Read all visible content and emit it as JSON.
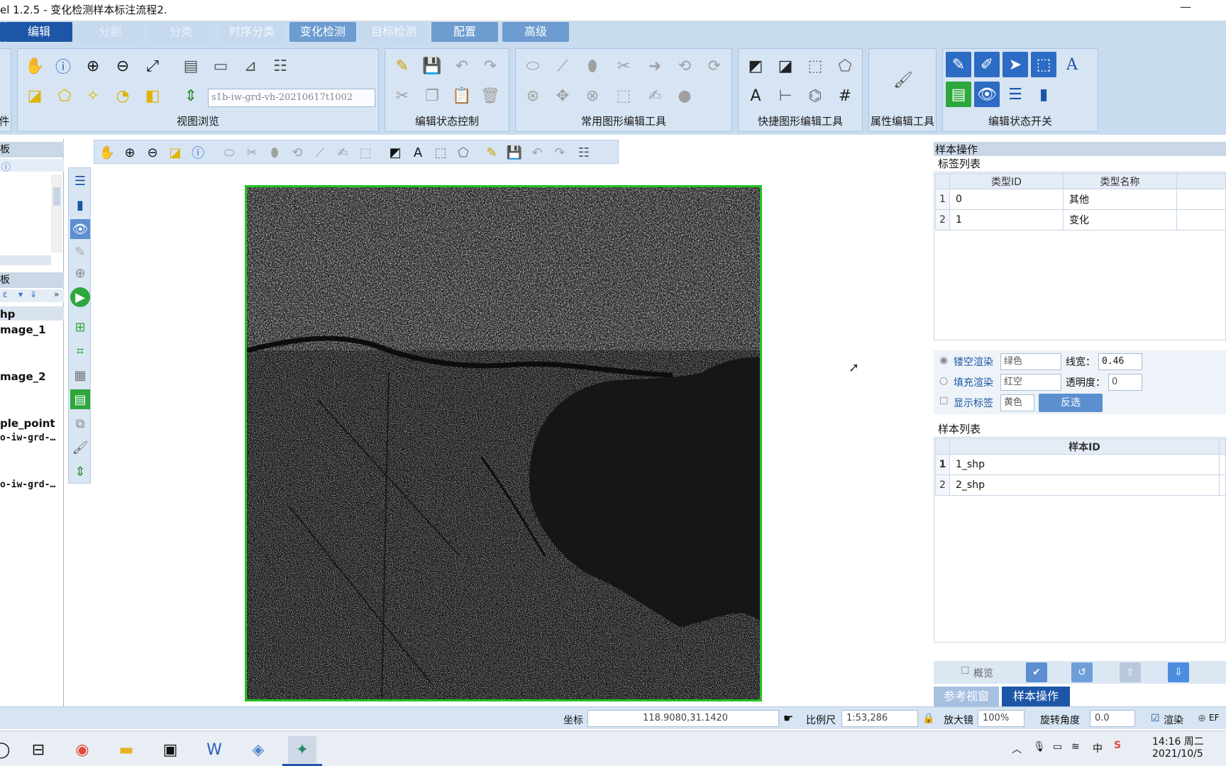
{
  "window": {
    "title": "el 1.2.5 - 变化检测样本标注流程2.",
    "minimize": "—"
  },
  "tabs": [
    {
      "label": "编辑",
      "state": "active"
    },
    {
      "label": "分割",
      "state": "dim"
    },
    {
      "label": "分类",
      "state": "dim"
    },
    {
      "label": "时序分类",
      "state": "normal"
    },
    {
      "label": "变化检测",
      "state": "normal"
    },
    {
      "label": "目标检测",
      "state": "normal"
    },
    {
      "label": "配置",
      "state": "normal"
    },
    {
      "label": "高级",
      "state": "normal"
    }
  ],
  "ribbon": {
    "left_fragment": "件",
    "groups": {
      "view_browse": "视图浏览",
      "edit_state_control": "编辑状态控制",
      "common_shape_tools": "常用图形编辑工具",
      "quick_shape_tools": "快捷图形编辑工具",
      "attribute_tools": "属性编辑工具",
      "edit_state_switch": "编辑状态开关"
    },
    "layer_combo": "s1b-iw-grd-vh-20210617t1002"
  },
  "left_panel": {
    "header1": "板",
    "header2": "板",
    "layers": [
      {
        "name": "hp",
        "style": "bold"
      },
      {
        "name": "mage_1",
        "style": "bold"
      },
      {
        "name": "mage_2",
        "style": "bold"
      },
      {
        "name": "ple_point",
        "style": "bold"
      },
      {
        "name": "o-iw-grd-…",
        "style": "mono"
      },
      {
        "name": "o-iw-grd-…",
        "style": "mono"
      }
    ]
  },
  "right_panel": {
    "title": "样本操作",
    "label_list": {
      "title": "标签列表",
      "columns": [
        "类型ID",
        "类型名称"
      ],
      "rows": [
        {
          "num": "1",
          "id": "0",
          "name": "其他"
        },
        {
          "num": "2",
          "id": "1",
          "name": "变化"
        }
      ]
    },
    "render": {
      "hollow": "镂空渲染",
      "hollow_color": "绿色",
      "line_width_label": "线宽：",
      "line_width": "0.46",
      "fill": "填充渲染",
      "fill_color": "红空",
      "opacity_label": "透明度：",
      "opacity": "0",
      "show_label": "显示标签",
      "label_color": "黄色",
      "invert": "反选"
    },
    "sample_list": {
      "title": "样本列表",
      "column": "样本ID",
      "rows": [
        {
          "num": "1",
          "id": "1_shp"
        },
        {
          "num": "2",
          "id": "2_shp"
        }
      ]
    },
    "overview": "概览",
    "bottom_tabs": {
      "ref_view": "参考视窗",
      "sample_ops": "样本操作"
    }
  },
  "status": {
    "coord_label": "坐标",
    "coord_value": "118.9080,31.1420",
    "scale_label": "比例尺",
    "scale_value": "1:53,286",
    "magnifier_label": "放大镜",
    "magnifier_value": "100%",
    "rotation_label": "旋转角度",
    "rotation_value": "0.0",
    "render_label": "渲染",
    "ef_label": "EF"
  },
  "taskbar": {
    "time": "14:16 周二",
    "date": "2021/10/5",
    "ime": "中"
  },
  "colors": {
    "accent": "#1d56a6",
    "ribbon_bg": "#c9dcef",
    "sample_frame": "#22c322"
  }
}
